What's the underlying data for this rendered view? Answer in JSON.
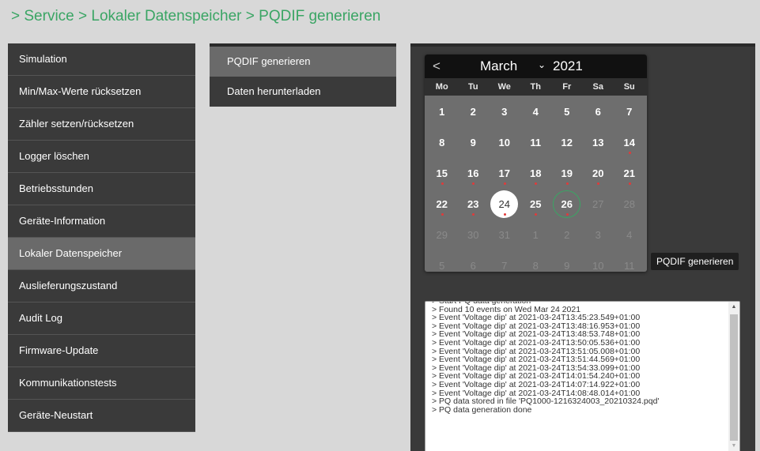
{
  "breadcrumb": "> Service > Lokaler Datenspeicher > PQDIF generieren",
  "left_menu": [
    {
      "label": "Simulation",
      "active": false
    },
    {
      "label": "Min/Max-Werte rücksetzen",
      "active": false
    },
    {
      "label": "Zähler setzen/rücksetzen",
      "active": false
    },
    {
      "label": "Logger löschen",
      "active": false
    },
    {
      "label": "Betriebsstunden",
      "active": false
    },
    {
      "label": "Geräte-Information",
      "active": false
    },
    {
      "label": "Lokaler Datenspeicher",
      "active": true
    },
    {
      "label": "Auslieferungszustand",
      "active": false
    },
    {
      "label": "Audit Log",
      "active": false
    },
    {
      "label": "Firmware-Update",
      "active": false
    },
    {
      "label": "Kommunikationstests",
      "active": false
    },
    {
      "label": "Geräte-Neustart",
      "active": false
    }
  ],
  "sub_menu": [
    {
      "label": "PQDIF generieren",
      "active": true
    },
    {
      "label": "Daten herunterladen",
      "active": false
    }
  ],
  "calendar": {
    "prev_icon": "<",
    "month": "March",
    "month_chevron": "⌄",
    "year": "2021",
    "weekdays": [
      "Mo",
      "Tu",
      "We",
      "Th",
      "Fr",
      "Sa",
      "Su"
    ],
    "weeks": [
      [
        {
          "d": "1"
        },
        {
          "d": "2"
        },
        {
          "d": "3"
        },
        {
          "d": "4"
        },
        {
          "d": "5"
        },
        {
          "d": "6"
        },
        {
          "d": "7"
        }
      ],
      [
        {
          "d": "8"
        },
        {
          "d": "9"
        },
        {
          "d": "10"
        },
        {
          "d": "11"
        },
        {
          "d": "12"
        },
        {
          "d": "13"
        },
        {
          "d": "14",
          "dot": true
        }
      ],
      [
        {
          "d": "15",
          "dot": true
        },
        {
          "d": "16",
          "dot": true
        },
        {
          "d": "17",
          "dot": true
        },
        {
          "d": "18",
          "dot": true
        },
        {
          "d": "19",
          "dot": true
        },
        {
          "d": "20",
          "dot": true
        },
        {
          "d": "21",
          "dot": true
        }
      ],
      [
        {
          "d": "22",
          "dot": true
        },
        {
          "d": "23",
          "dot": true
        },
        {
          "d": "24",
          "dot": true,
          "selected": true
        },
        {
          "d": "25",
          "dot": true
        },
        {
          "d": "26",
          "dot": true,
          "today": true
        },
        {
          "d": "27",
          "muted": true
        },
        {
          "d": "28",
          "muted": true
        }
      ],
      [
        {
          "d": "29",
          "muted": true
        },
        {
          "d": "30",
          "muted": true
        },
        {
          "d": "31",
          "muted": true
        },
        {
          "d": "1",
          "muted": true
        },
        {
          "d": "2",
          "muted": true
        },
        {
          "d": "3",
          "muted": true
        },
        {
          "d": "4",
          "muted": true
        }
      ],
      [
        {
          "d": "5",
          "muted": true
        },
        {
          "d": "6",
          "muted": true
        },
        {
          "d": "7",
          "muted": true
        },
        {
          "d": "8",
          "muted": true
        },
        {
          "d": "9",
          "muted": true
        },
        {
          "d": "10",
          "muted": true
        },
        {
          "d": "11",
          "muted": true
        }
      ]
    ]
  },
  "generate_button": "PQDIF generieren",
  "log_lines": [
    "> Start PQ data generation",
    "> Found 10 events on Wed Mar 24 2021",
    "> Event 'Voltage dip' at 2021-03-24T13:45:23.549+01:00",
    "> Event 'Voltage dip' at 2021-03-24T13:48:16.953+01:00",
    "> Event 'Voltage dip' at 2021-03-24T13:48:53.748+01:00",
    "> Event 'Voltage dip' at 2021-03-24T13:50:05.536+01:00",
    "> Event 'Voltage dip' at 2021-03-24T13:51:05.008+01:00",
    "> Event 'Voltage dip' at 2021-03-24T13:51:44.569+01:00",
    "> Event 'Voltage dip' at 2021-03-24T13:54:33.099+01:00",
    "> Event 'Voltage dip' at 2021-03-24T14:01:54.240+01:00",
    "> Event 'Voltage dip' at 2021-03-24T14:07:14.922+01:00",
    "> Event 'Voltage dip' at 2021-03-24T14:08:48.014+01:00",
    "> PQ data stored in file 'PQ1000-1216324003_20210324.pqd'",
    "> PQ data generation done"
  ],
  "colors": {
    "accent_green": "#3aa564",
    "event_dot_red": "#e23a3a",
    "menu_bg": "#3a3a3a",
    "menu_active": "#6a6a6a"
  },
  "icons": {
    "scroll_up": "▲",
    "scroll_down": "▼"
  }
}
